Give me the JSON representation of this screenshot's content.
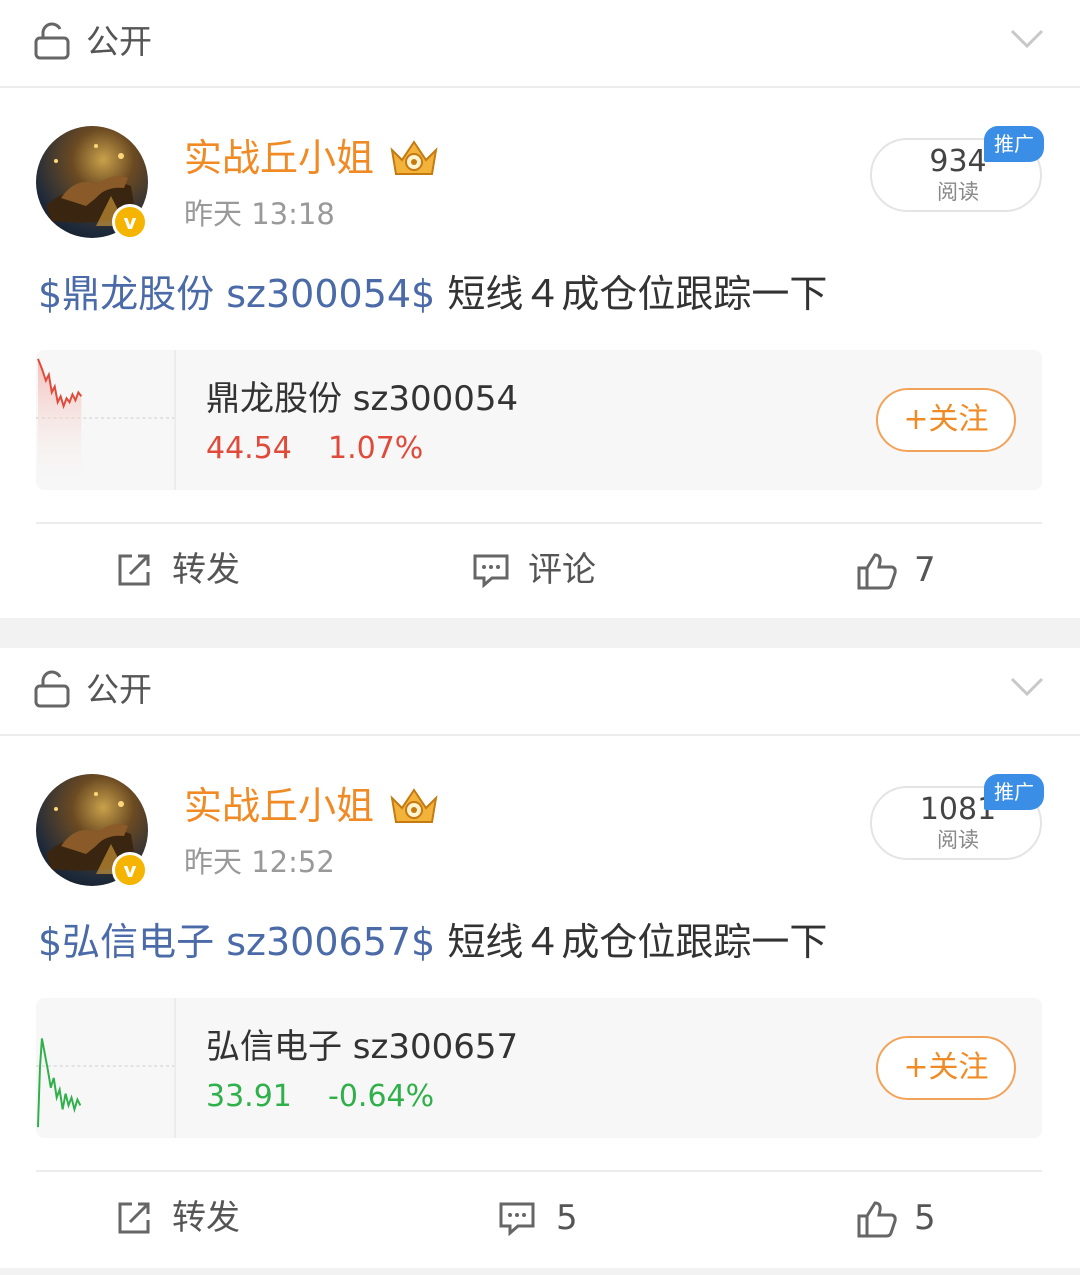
{
  "posts": [
    {
      "visibility": "公开",
      "username": "实战丘小姐",
      "timestamp": "昨天 13:18",
      "reads": "934",
      "reads_label": "阅读",
      "promo": "推广",
      "stock_link": "$鼎龙股份 sz300054$",
      "body": " 短线４成仓位跟踪一下",
      "stock": {
        "name": "鼎龙股份 sz300054",
        "price": "44.54",
        "change": "1.07%",
        "direction": "up"
      },
      "follow_label": "+关注",
      "actions": {
        "repost": "转发",
        "comment": "评论",
        "like": "7"
      }
    },
    {
      "visibility": "公开",
      "username": "实战丘小姐",
      "timestamp": "昨天 12:52",
      "reads": "1081",
      "reads_label": "阅读",
      "promo": "推广",
      "stock_link": "$弘信电子 sz300657$",
      "body": " 短线４成仓位跟踪一下",
      "stock": {
        "name": "弘信电子 sz300657",
        "price": "33.91",
        "change": "-0.64%",
        "direction": "down"
      },
      "follow_label": "+关注",
      "actions": {
        "repost": "转发",
        "comment": "5",
        "like": "5"
      }
    }
  ],
  "colors": {
    "accent": "#f08a24",
    "link": "#4a6aa8",
    "up": "#e04a3a",
    "down": "#2fb04a",
    "promo": "#3a8ee6"
  },
  "icons": {
    "visibility": "lock-open-icon",
    "expand": "chevron-down-icon",
    "repost": "share-icon",
    "comment": "comment-icon",
    "like": "thumbs-up-icon",
    "verified": "verified-v-icon"
  }
}
